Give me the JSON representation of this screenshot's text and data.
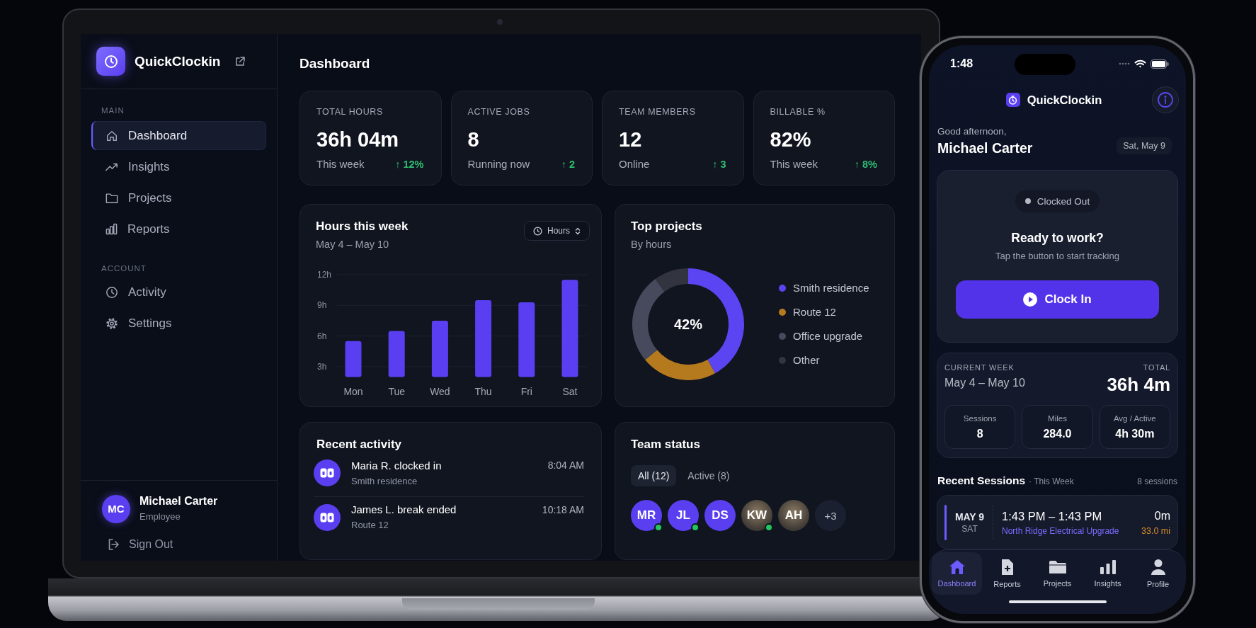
{
  "laptop": {
    "sidebar": {
      "brand": "QuickClockin",
      "sections": [
        {
          "title": "MAIN",
          "items": [
            {
              "label": "Dashboard",
              "selected": true
            },
            {
              "label": "Insights",
              "selected": false
            },
            {
              "label": "Projects",
              "selected": false
            },
            {
              "label": "Reports",
              "selected": false
            }
          ]
        },
        {
          "title": "ACCOUNT",
          "items": [
            {
              "label": "Activity",
              "selected": false
            },
            {
              "label": "Settings",
              "selected": false
            }
          ]
        }
      ],
      "user": {
        "initials": "MC",
        "name": "Michael Carter",
        "role": "Employee"
      },
      "sign_out": "Sign Out"
    },
    "page_title": "Dashboard",
    "stats": [
      {
        "label": "TOTAL HOURS",
        "value": "36h 04m",
        "caption": "This week",
        "trend": "↑ 12%"
      },
      {
        "label": "ACTIVE JOBS",
        "value": "8",
        "caption": "Running now",
        "trend": "↑ 2"
      },
      {
        "label": "TEAM MEMBERS",
        "value": "12",
        "caption": "Online",
        "trend": "↑ 3"
      },
      {
        "label": "BILLABLE %",
        "value": "82%",
        "caption": "This week",
        "trend": "↑ 8%"
      }
    ],
    "hours_panel": {
      "title": "Hours this week",
      "subtitle": "May 4 – May 10",
      "unit_select": "Hours",
      "chart_data": {
        "type": "bar",
        "categories": [
          "Mon",
          "Tue",
          "Wed",
          "Thu",
          "Fri",
          "Sat"
        ],
        "series": [
          {
            "color": "#5a3ff2",
            "values": [
              5.5,
              6.5,
              7.5,
              9.5,
              9.3,
              11.5
            ]
          }
        ],
        "grid": true,
        "ylim": [
          2,
          12
        ],
        "yticks": [
          {
            "value": 3,
            "label": "3h"
          },
          {
            "value": 6,
            "label": "6h"
          },
          {
            "value": 9,
            "label": "9h"
          },
          {
            "value": 12,
            "label": "12h"
          }
        ]
      }
    },
    "top_projects": {
      "title": "Top projects",
      "subtitle": "By hours",
      "center_label": "42%",
      "chart_data": {
        "type": "donut",
        "categories": [
          "Smith residence",
          "Route 12",
          "Office upgrade",
          "Other"
        ],
        "colors": [
          "#5b45f2",
          "#b57a1e",
          "#474a5c",
          "#32343f"
        ],
        "series": [
          {
            "values": [
              42,
              22,
              26,
              10
            ]
          }
        ]
      }
    },
    "recent_activity": {
      "title": "Recent activity",
      "items": [
        {
          "title": "Maria R. clocked in",
          "subtitle": "Smith residence",
          "time": "8:04 AM"
        },
        {
          "title": "James L. break ended",
          "subtitle": "Route 12",
          "time": "10:18 AM"
        }
      ]
    },
    "team_status": {
      "title": "Team status",
      "filters": [
        {
          "label": "All (12)",
          "selected": true
        },
        {
          "label": "Active (8)",
          "selected": false
        }
      ],
      "members": [
        {
          "initials": "MR",
          "kind": "initials",
          "online": true
        },
        {
          "initials": "JL",
          "kind": "initials",
          "online": true
        },
        {
          "initials": "DS",
          "kind": "initials",
          "online": false
        },
        {
          "initials": "KW",
          "kind": "photo",
          "online": true
        },
        {
          "initials": "AH",
          "kind": "photo",
          "online": false
        }
      ],
      "more": "+3"
    }
  },
  "phone": {
    "status_bar": {
      "time": "1:48"
    },
    "brand": "QuickClockin",
    "greeting": "Good afternoon,",
    "name": "Michael Carter",
    "date": "Sat, May 9",
    "clock_card": {
      "status": "Clocked Out",
      "heading": "Ready to work?",
      "hint": "Tap the button to start tracking",
      "button": "Clock In"
    },
    "week": {
      "label": "CURRENT WEEK",
      "range": "May 4 – May 10",
      "total_label": "TOTAL",
      "total": "36h 4m",
      "stats": [
        {
          "label": "Sessions",
          "value": "8"
        },
        {
          "label": "Miles",
          "value": "284.0"
        },
        {
          "label": "Avg / Active",
          "value": "4h 30m"
        }
      ]
    },
    "recent_sessions": {
      "title": "Recent Sessions",
      "subtitle": "· This Week",
      "count": "8 sessions",
      "items": [
        {
          "date": "MAY 9",
          "weekday": "SAT",
          "time_range": "1:43 PM – 1:43 PM",
          "project": "North Ridge Electrical Upgrade",
          "duration": "0m",
          "distance": "33.0 mi"
        }
      ]
    },
    "tab_bar": [
      {
        "label": "Dashboard",
        "selected": true
      },
      {
        "label": "Reports",
        "selected": false
      },
      {
        "label": "Projects",
        "selected": false
      },
      {
        "label": "Insights",
        "selected": false
      },
      {
        "label": "Profile",
        "selected": false
      }
    ]
  }
}
